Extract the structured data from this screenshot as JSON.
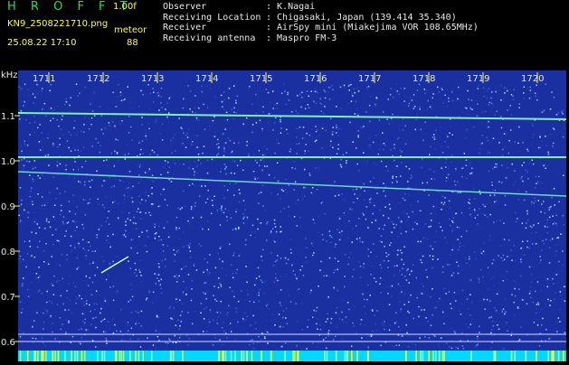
{
  "header": {
    "brand": "H R O F F T",
    "version": "1.00f",
    "filename": "KN9_2508221710.png",
    "datetime": "25.08.22 17:10",
    "meteor_label": "meteor",
    "meteor_count": "88",
    "fields": [
      {
        "key": "Observer",
        "value": ": K.Nagai"
      },
      {
        "key": "Receiving Location",
        "value": ": Chigasaki, Japan (139.414 35.340)"
      },
      {
        "key": "Receiver",
        "value": ": AirSpy mini (Miakejima VOR 108.65MHz)"
      },
      {
        "key": "Receiving antenna",
        "value": ": Maspro FM-3"
      }
    ]
  },
  "plot": {
    "unit_label": "kHz",
    "time_ticks": [
      "1711",
      "1712",
      "1713",
      "1714",
      "1715",
      "1716",
      "1717",
      "1718",
      "1719",
      "1720"
    ],
    "freq_ticks": [
      "1.1",
      "1.0",
      "0.9",
      "0.8",
      "0.7",
      "0.6"
    ],
    "colors": {
      "background": "#1a2fa0",
      "noise": "#6fa9ff",
      "signal": "#7ff0b0",
      "grid": "#ffffff",
      "scale": "#ffff33",
      "bottom": "#00e0ff"
    }
  }
}
